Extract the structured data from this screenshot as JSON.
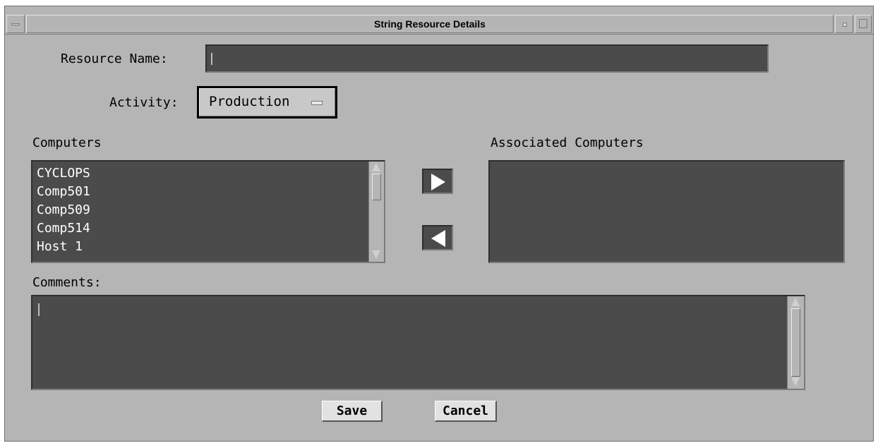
{
  "window": {
    "title": "String Resource Details"
  },
  "form": {
    "resource_name_label": "Resource Name:",
    "resource_name_value": "",
    "activity_label": "Activity:",
    "activity_value": "Production"
  },
  "computers": {
    "label": "Computers",
    "items": [
      "CYCLOPS",
      "Comp501",
      "Comp509",
      "Comp514",
      "Host 1"
    ]
  },
  "associated": {
    "label": "Associated Computers",
    "items": []
  },
  "comments": {
    "label": "Comments:",
    "value": ""
  },
  "buttons": {
    "save": "Save",
    "cancel": "Cancel"
  },
  "icons": {
    "window_menu": "window-menu-icon",
    "minimize": "minimize-icon",
    "maximize": "maximize-icon",
    "add": "right-arrow-icon",
    "remove": "left-arrow-icon",
    "option_indicator": "option-menu-indicator-icon"
  },
  "colors": {
    "window_bg": "#b5b5b5",
    "field_bg": "#4b4b4b",
    "list_text": "#ffffff"
  }
}
